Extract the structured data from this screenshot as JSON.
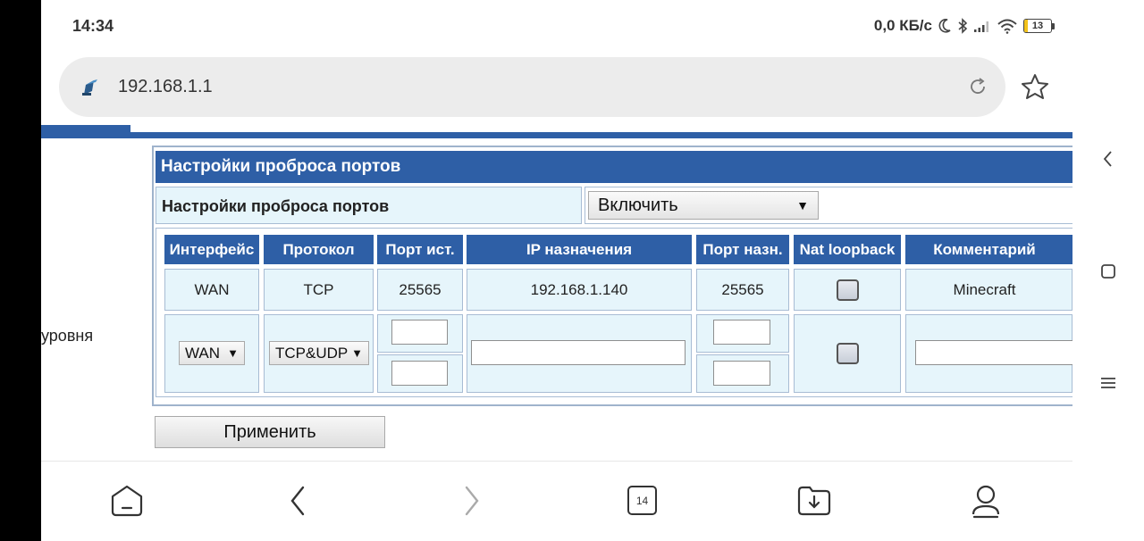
{
  "status_bar": {
    "time": "14:34",
    "network_speed": "0,0 КБ/с",
    "battery_level": "13",
    "battery_fraction": 0.13,
    "icons": [
      "moon-icon",
      "bluetooth-icon",
      "signal-icon",
      "wifi-icon",
      "battery-icon"
    ]
  },
  "browser": {
    "url": "192.168.1.1",
    "tab_count": "14",
    "icons": [
      "site-icon",
      "reload-icon",
      "star-icon",
      "home-icon",
      "back-icon",
      "forward-icon",
      "downloads-icon",
      "profile-icon"
    ]
  },
  "page": {
    "side_text": "уровня",
    "section_title": "Настройки проброса портов",
    "setting_label": "Настройки проброса портов",
    "setting_value": "Включить",
    "table": {
      "headers": [
        "Интерфейс",
        "Протокол",
        "Порт ист.",
        "IP назначения",
        "Порт назн.",
        "Nat loopback",
        "Комментарий"
      ],
      "row": {
        "interface": "WAN",
        "protocol": "TCP",
        "src_port": "25565",
        "dest_ip": "192.168.1.140",
        "dest_port": "25565",
        "nat_loopback": false,
        "comment": "Minecraft"
      },
      "new_row": {
        "interface": "WAN",
        "protocol": "TCP&UDP",
        "src_port_from": "",
        "src_port_to": "",
        "dest_ip": "",
        "dest_port_from": "",
        "dest_port_to": "",
        "nat_loopback": false,
        "comment": ""
      }
    },
    "apply_label": "Применить"
  },
  "colors": {
    "header_blue": "#2e5fa6",
    "cell_bg": "#e6f5fb",
    "battery_yellow": "#f2c21b"
  }
}
